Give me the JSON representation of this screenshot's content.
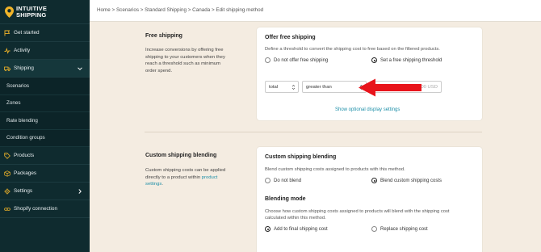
{
  "brand": {
    "line1": "INTUITIVE",
    "line2": "SHIPPING"
  },
  "sidebar": {
    "items": [
      {
        "label": "Get started",
        "icon": "flag-icon"
      },
      {
        "label": "Activity",
        "icon": "activity-icon"
      },
      {
        "label": "Shipping",
        "icon": "truck-icon"
      },
      {
        "label": "Products",
        "icon": "tag-icon"
      },
      {
        "label": "Packages",
        "icon": "box-icon"
      },
      {
        "label": "Settings",
        "icon": "gear-icon"
      },
      {
        "label": "Shopify connection",
        "icon": "link-icon"
      }
    ],
    "sub_items": [
      "Scenarios",
      "Zones",
      "Rate blending",
      "Condition groups"
    ],
    "accent": "#f0b429"
  },
  "breadcrumb": "Home > Scenarios > Standard Shipping > Canada > Edit shipping method",
  "free_shipping": {
    "title": "Free shipping",
    "desc_lines": [
      "Increase conversions by offering free",
      "shipping to your customers when they",
      "reach a threshold such as minimum",
      "order spend."
    ],
    "card_title": "Offer free shipping",
    "card_text": "Define a threshold to convert the shipping cost to free based on the filtered products.",
    "radio_off": "Do not offer free shipping",
    "radio_on": "Set a free shipping threshold",
    "select1": "total",
    "select2": "greater than",
    "input_suffix": "0.00 USD",
    "link": "Show optional display settings"
  },
  "blending": {
    "title": "Custom shipping blending",
    "desc_line1": "Custom shipping costs can be applied",
    "desc_line2a": "directly to a product within ",
    "desc_link": "product",
    "desc_line3": "settings",
    "desc_end": ".",
    "card_title": "Custom shipping blending",
    "card_text": "Blend custom shipping costs assigned to products with this method.",
    "radio_off": "Do not blend",
    "radio_on": "Blend custom shipping costs",
    "mode_title": "Blending mode",
    "mode_text_lines": [
      "Choose how custom shipping costs assigned to products will blend with the shipping cost",
      "calculated within this method."
    ],
    "mode_on": "Add to final shipping cost",
    "mode_off": "Replace shipping cost"
  },
  "colors": {
    "sidebar_bg": "#0f2b2f",
    "page_bg": "#f4ece1",
    "link": "#1e8fa8",
    "arrow": "#e8141b"
  }
}
